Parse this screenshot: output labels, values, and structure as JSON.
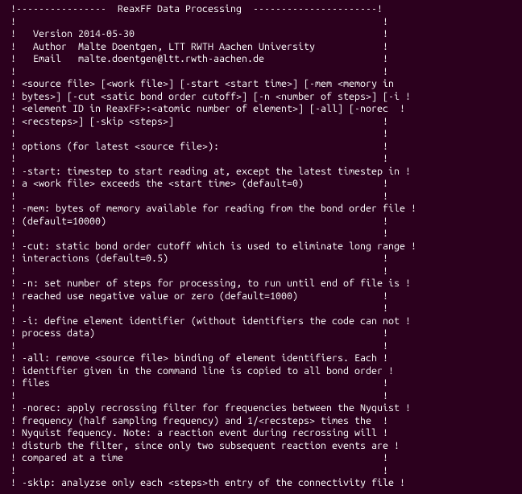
{
  "term": {
    "lines": [
      " !----------------  ReaxFF Data Processing  ----------------------!",
      " !                                                                 !",
      " !   Version 2014-05-30                                            !",
      " !   Author  Malte Doentgen, LTT RWTH Aachen University            !",
      " !   Email   malte.doentgen@ltt.rwth-aachen.de                     !",
      " !                                                                 !",
      " ! <source file> [<work file>] [-start <start time>] [-mem <memory in",
      " ! bytes>] [-cut <satic bond order cutoff>] [-n <number of steps>] [-i !",
      " ! <element ID in ReaxFF>:<atomic number of element>] [-all] [-norec  !",
      " ! <recsteps>] [-skip <steps>]                                     !",
      " !                                                                 !",
      " ! options (for latest <source file>):                             !",
      " !                                                                 !",
      " ! -start: timestep to start reading at, except the latest timestep in !",
      " ! a <work file> exceeds the <start time> (default=0)              !",
      " !                                                                 !",
      " ! -mem: bytes of memory available for reading from the bond order file !",
      " ! (default=10000)                                                 !",
      " !                                                                 !",
      " ! -cut: static bond order cutoff which is used to eliminate long range !",
      " ! interactions (default=0.5)                                      !",
      " !                                                                 !",
      " ! -n: set number of steps for processing, to run until end of file is !",
      " ! reached use negative value or zero (default=1000)               !",
      " !                                                                 !",
      " ! -i: define element identifier (without identifiers the code can not !",
      " ! process data)                                                   !",
      " !                                                                 !",
      " ! -all: remove <source file> binding of element identifiers. Each !",
      " ! identifier given in the command line is copied to all bond order !",
      " ! files                                                           !",
      " !                                                                 !",
      " ! -norec: apply recrossing filter for frequencies between the Nyquist !",
      " ! frequency (half sampling frequency) and 1/<recsteps> times the  !",
      " ! Nyquist fequency. Note: a reaction event during recrossing will !",
      " ! disturb the filter, since only two subsequent reaction events are !",
      " ! compared at a time                                              !",
      " !                                                                 !",
      " ! -skip: analyzse only each <steps>th entry of the connectivity file !"
    ]
  }
}
